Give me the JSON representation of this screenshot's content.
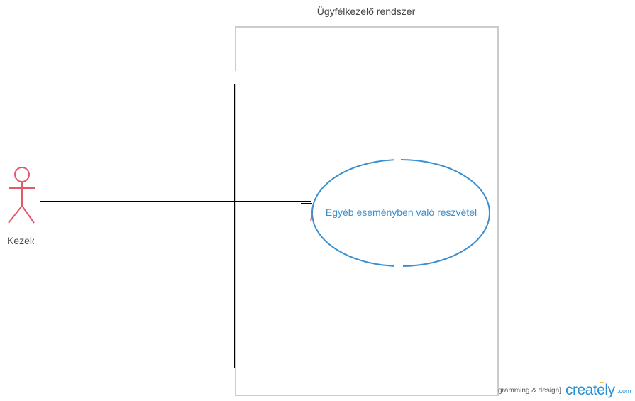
{
  "diagram": {
    "system": {
      "title": "Ügyfélkezelő rendszer"
    },
    "actor": {
      "label": "Kezelő",
      "color": "#e05a6a"
    },
    "use_case": {
      "label": "Egyéb eseményben való részvétel",
      "color": "#3a8fd0"
    }
  },
  "watermark": {
    "text": "gramming & design]",
    "brand": "creately",
    "suffix": ".com"
  }
}
